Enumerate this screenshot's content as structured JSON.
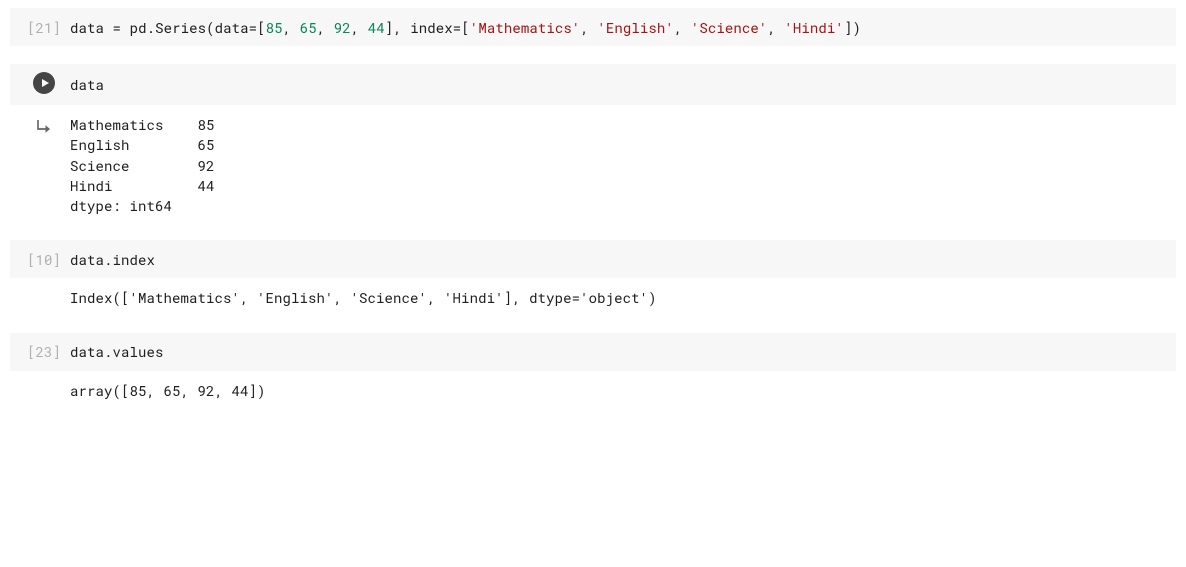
{
  "cells": {
    "c1": {
      "execution_label": "[21]",
      "code": {
        "prefix": "data = pd.Series(data=[",
        "nums": [
          "85",
          "65",
          "92",
          "44"
        ],
        "mid": "], index=[",
        "strs": [
          "'Mathematics'",
          "'English'",
          "'Science'",
          "'Hindi'"
        ],
        "suffix": "])"
      }
    },
    "c2": {
      "code": "data",
      "output": "Mathematics    85\nEnglish        65\nScience        92\nHindi          44\ndtype: int64"
    },
    "c3": {
      "execution_label": "[10]",
      "code": "data.index",
      "output": "Index(['Mathematics', 'English', 'Science', 'Hindi'], dtype='object')"
    },
    "c4": {
      "execution_label": "[23]",
      "code": "data.values",
      "output": "array([85, 65, 92, 44])"
    }
  },
  "sep": ", "
}
